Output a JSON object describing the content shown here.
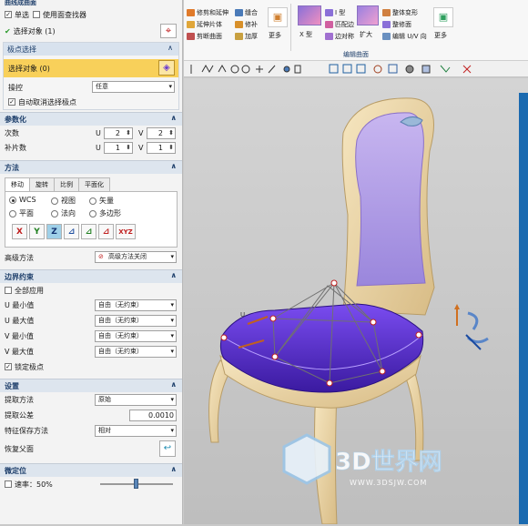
{
  "panel": {
    "top_title": "曲线成曲面",
    "single_select": "单选",
    "use_finder": "使用面查找器",
    "selected_label": "选择对象 (1)",
    "pole": {
      "title": "极点选择",
      "select_label": "选择对象 (0)",
      "control_label": "操控",
      "control_value": "任意",
      "auto_deselect": "自动取消选择极点"
    },
    "param": {
      "title": "参数化",
      "degree_label": "次数",
      "patches_label": "补片数",
      "u": "U",
      "v": "V",
      "degree_u": "2",
      "degree_v": "2",
      "patch_u": "1",
      "patch_v": "1"
    },
    "method": {
      "title": "方法",
      "tabs": [
        "移动",
        "旋转",
        "比例",
        "平面化"
      ],
      "radios": [
        "WCS",
        "视图",
        "矢量",
        "平面",
        "法向",
        "多边形"
      ],
      "axis_buttons": [
        "X",
        "Y",
        "Z",
        "",
        "",
        "",
        "XYZ"
      ],
      "advanced_label": "高级方法",
      "advanced_value": "高级方法关闭"
    },
    "boundary": {
      "title": "边界约束",
      "apply_all": "全部应用",
      "rows": [
        {
          "label": "U 最小值",
          "value": "自由（无约束）"
        },
        {
          "label": "U 最大值",
          "value": "自由（无约束）"
        },
        {
          "label": "V 最小值",
          "value": "自由（无约束）"
        },
        {
          "label": "V 最大值",
          "value": "自由（无约束）"
        }
      ],
      "lock_poles": "锁定极点"
    },
    "settings": {
      "title": "设置",
      "extract_method_label": "提取方法",
      "extract_method_value": "原始",
      "tolerance_label": "提取公差",
      "tolerance_value": "0.0010",
      "feature_save_label": "特征保存方法",
      "feature_save_value": "相对",
      "restore_label": "恢复父面"
    },
    "fine": {
      "title": "微定位",
      "speed_label": "速率：50%",
      "speed": 0.5
    }
  },
  "ribbon": {
    "col1": [
      "修剪和延伸",
      "延伸片体",
      "剪断曲面"
    ],
    "col2": [
      "缝合",
      "修补",
      "加厚"
    ],
    "more": "更多",
    "x_type": "X 型",
    "col3": [
      "I 型",
      "匹配边",
      "边对称"
    ],
    "expand": "扩大",
    "col4": [
      "整体变形",
      "整修面",
      "编辑 U/V 向"
    ],
    "group_label": "编辑曲面"
  },
  "viewport": {
    "u_label": "U",
    "watermark_main": "3D世界网",
    "watermark_sub": "WWW.3DSJW.COM"
  },
  "colors": {
    "accent": "#1f4f87",
    "pole_highlight": "#f8d05a",
    "surface": "#5a2ad0",
    "wood": "#efdcb0"
  }
}
